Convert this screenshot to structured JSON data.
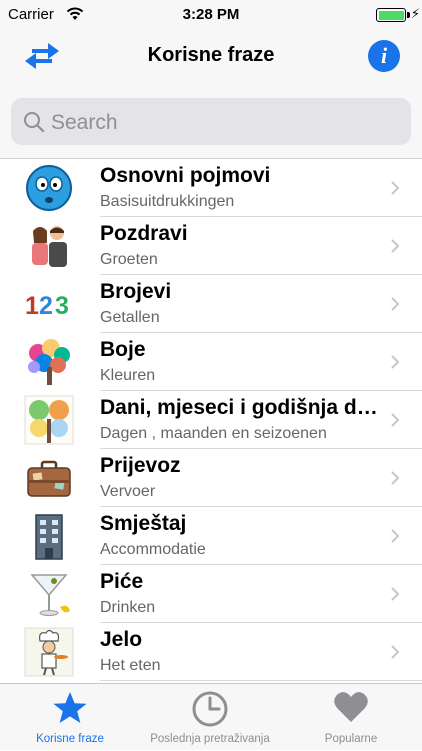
{
  "status_bar": {
    "carrier": "Carrier",
    "time": "3:28 PM"
  },
  "nav": {
    "title": "Korisne fraze",
    "left_icon": "swap-arrows-icon",
    "right_icon": "info-icon"
  },
  "search": {
    "placeholder": "Search"
  },
  "categories": [
    {
      "title": "Osnovni pojmovi",
      "subtitle": "Basisuitdrukkingen",
      "icon": "smiley-face-icon"
    },
    {
      "title": "Pozdravi",
      "subtitle": "Groeten",
      "icon": "greeting-couple-icon"
    },
    {
      "title": "Brojevi",
      "subtitle": "Getallen",
      "icon": "numbers-123-icon"
    },
    {
      "title": "Boje",
      "subtitle": "Kleuren",
      "icon": "colorful-tree-icon"
    },
    {
      "title": "Dani, mjeseci i godišnja doba",
      "subtitle": "Dagen , maanden en seizoenen",
      "icon": "seasons-tree-icon"
    },
    {
      "title": "Prijevoz",
      "subtitle": "Vervoer",
      "icon": "suitcase-icon"
    },
    {
      "title": "Smještaj",
      "subtitle": "Accommodatie",
      "icon": "building-icon"
    },
    {
      "title": "Piće",
      "subtitle": "Drinken",
      "icon": "cocktail-glass-icon"
    },
    {
      "title": "Jelo",
      "subtitle": "Het eten",
      "icon": "chef-icon"
    }
  ],
  "tabs": [
    {
      "label": "Korisne fraze",
      "icon": "star-icon",
      "active": true
    },
    {
      "label": "Poslednja pretraživanja",
      "icon": "clock-icon",
      "active": false
    },
    {
      "label": "Popularne",
      "icon": "heart-icon",
      "active": false
    }
  ],
  "colors": {
    "accent": "#1a73e8",
    "bar_background": "#f7f7f7",
    "inactive_tab": "#8e8e93"
  }
}
